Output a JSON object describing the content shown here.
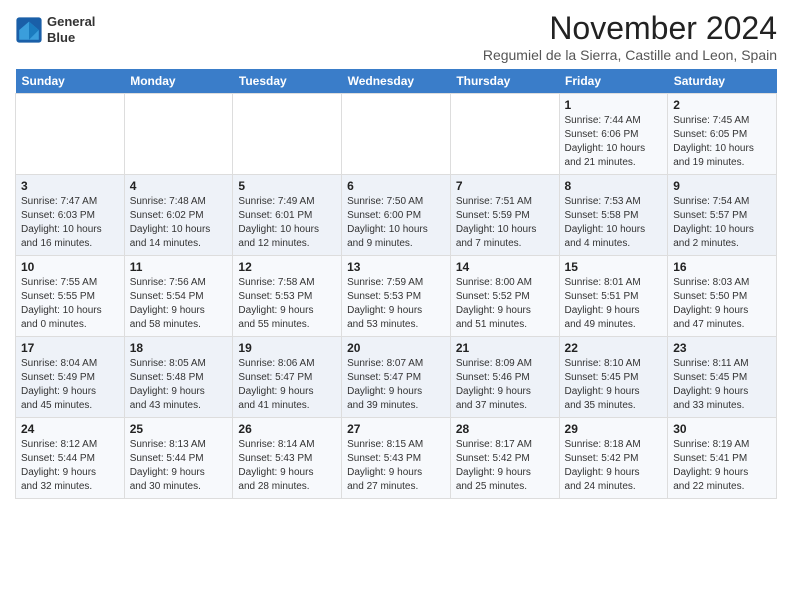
{
  "header": {
    "logo_line1": "General",
    "logo_line2": "Blue",
    "title": "November 2024",
    "subtitle": "Regumiel de la Sierra, Castille and Leon, Spain"
  },
  "weekdays": [
    "Sunday",
    "Monday",
    "Tuesday",
    "Wednesday",
    "Thursday",
    "Friday",
    "Saturday"
  ],
  "weeks": [
    [
      {
        "day": "",
        "info": ""
      },
      {
        "day": "",
        "info": ""
      },
      {
        "day": "",
        "info": ""
      },
      {
        "day": "",
        "info": ""
      },
      {
        "day": "",
        "info": ""
      },
      {
        "day": "1",
        "info": "Sunrise: 7:44 AM\nSunset: 6:06 PM\nDaylight: 10 hours\nand 21 minutes."
      },
      {
        "day": "2",
        "info": "Sunrise: 7:45 AM\nSunset: 6:05 PM\nDaylight: 10 hours\nand 19 minutes."
      }
    ],
    [
      {
        "day": "3",
        "info": "Sunrise: 7:47 AM\nSunset: 6:03 PM\nDaylight: 10 hours\nand 16 minutes."
      },
      {
        "day": "4",
        "info": "Sunrise: 7:48 AM\nSunset: 6:02 PM\nDaylight: 10 hours\nand 14 minutes."
      },
      {
        "day": "5",
        "info": "Sunrise: 7:49 AM\nSunset: 6:01 PM\nDaylight: 10 hours\nand 12 minutes."
      },
      {
        "day": "6",
        "info": "Sunrise: 7:50 AM\nSunset: 6:00 PM\nDaylight: 10 hours\nand 9 minutes."
      },
      {
        "day": "7",
        "info": "Sunrise: 7:51 AM\nSunset: 5:59 PM\nDaylight: 10 hours\nand 7 minutes."
      },
      {
        "day": "8",
        "info": "Sunrise: 7:53 AM\nSunset: 5:58 PM\nDaylight: 10 hours\nand 4 minutes."
      },
      {
        "day": "9",
        "info": "Sunrise: 7:54 AM\nSunset: 5:57 PM\nDaylight: 10 hours\nand 2 minutes."
      }
    ],
    [
      {
        "day": "10",
        "info": "Sunrise: 7:55 AM\nSunset: 5:55 PM\nDaylight: 10 hours\nand 0 minutes."
      },
      {
        "day": "11",
        "info": "Sunrise: 7:56 AM\nSunset: 5:54 PM\nDaylight: 9 hours\nand 58 minutes."
      },
      {
        "day": "12",
        "info": "Sunrise: 7:58 AM\nSunset: 5:53 PM\nDaylight: 9 hours\nand 55 minutes."
      },
      {
        "day": "13",
        "info": "Sunrise: 7:59 AM\nSunset: 5:53 PM\nDaylight: 9 hours\nand 53 minutes."
      },
      {
        "day": "14",
        "info": "Sunrise: 8:00 AM\nSunset: 5:52 PM\nDaylight: 9 hours\nand 51 minutes."
      },
      {
        "day": "15",
        "info": "Sunrise: 8:01 AM\nSunset: 5:51 PM\nDaylight: 9 hours\nand 49 minutes."
      },
      {
        "day": "16",
        "info": "Sunrise: 8:03 AM\nSunset: 5:50 PM\nDaylight: 9 hours\nand 47 minutes."
      }
    ],
    [
      {
        "day": "17",
        "info": "Sunrise: 8:04 AM\nSunset: 5:49 PM\nDaylight: 9 hours\nand 45 minutes."
      },
      {
        "day": "18",
        "info": "Sunrise: 8:05 AM\nSunset: 5:48 PM\nDaylight: 9 hours\nand 43 minutes."
      },
      {
        "day": "19",
        "info": "Sunrise: 8:06 AM\nSunset: 5:47 PM\nDaylight: 9 hours\nand 41 minutes."
      },
      {
        "day": "20",
        "info": "Sunrise: 8:07 AM\nSunset: 5:47 PM\nDaylight: 9 hours\nand 39 minutes."
      },
      {
        "day": "21",
        "info": "Sunrise: 8:09 AM\nSunset: 5:46 PM\nDaylight: 9 hours\nand 37 minutes."
      },
      {
        "day": "22",
        "info": "Sunrise: 8:10 AM\nSunset: 5:45 PM\nDaylight: 9 hours\nand 35 minutes."
      },
      {
        "day": "23",
        "info": "Sunrise: 8:11 AM\nSunset: 5:45 PM\nDaylight: 9 hours\nand 33 minutes."
      }
    ],
    [
      {
        "day": "24",
        "info": "Sunrise: 8:12 AM\nSunset: 5:44 PM\nDaylight: 9 hours\nand 32 minutes."
      },
      {
        "day": "25",
        "info": "Sunrise: 8:13 AM\nSunset: 5:44 PM\nDaylight: 9 hours\nand 30 minutes."
      },
      {
        "day": "26",
        "info": "Sunrise: 8:14 AM\nSunset: 5:43 PM\nDaylight: 9 hours\nand 28 minutes."
      },
      {
        "day": "27",
        "info": "Sunrise: 8:15 AM\nSunset: 5:43 PM\nDaylight: 9 hours\nand 27 minutes."
      },
      {
        "day": "28",
        "info": "Sunrise: 8:17 AM\nSunset: 5:42 PM\nDaylight: 9 hours\nand 25 minutes."
      },
      {
        "day": "29",
        "info": "Sunrise: 8:18 AM\nSunset: 5:42 PM\nDaylight: 9 hours\nand 24 minutes."
      },
      {
        "day": "30",
        "info": "Sunrise: 8:19 AM\nSunset: 5:41 PM\nDaylight: 9 hours\nand 22 minutes."
      }
    ]
  ]
}
